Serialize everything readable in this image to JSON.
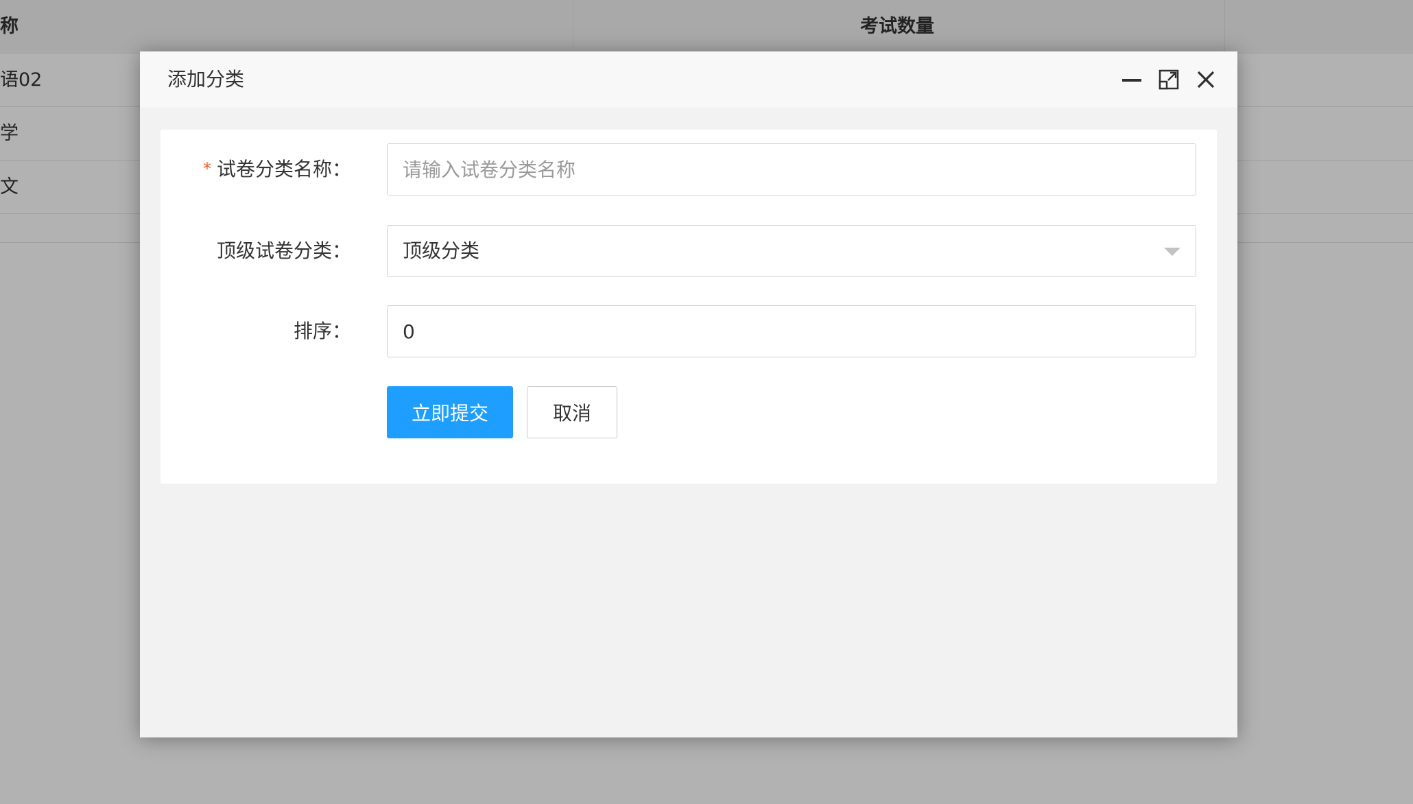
{
  "background_table": {
    "columns": [
      {
        "label": "称"
      },
      {
        "label": "考试数量"
      }
    ],
    "rows": [
      {
        "name": "语02"
      },
      {
        "name": "学"
      },
      {
        "name": "文"
      }
    ]
  },
  "dialog": {
    "title": "添加分类",
    "tools": {
      "minimize_icon": "minimize-icon",
      "maximize_icon": "maximize-icon",
      "close_icon": "close-icon"
    },
    "form": {
      "name_field": {
        "label": "试卷分类名称：",
        "required_mark": "*",
        "placeholder": "请输入试卷分类名称",
        "value": ""
      },
      "parent_field": {
        "label": "顶级试卷分类：",
        "selected": "顶级分类"
      },
      "sort_field": {
        "label": "排序：",
        "value": "0"
      },
      "submit_label": "立即提交",
      "cancel_label": "取消"
    }
  },
  "colors": {
    "primary": "#1e9fff",
    "required": "#ff5722"
  }
}
